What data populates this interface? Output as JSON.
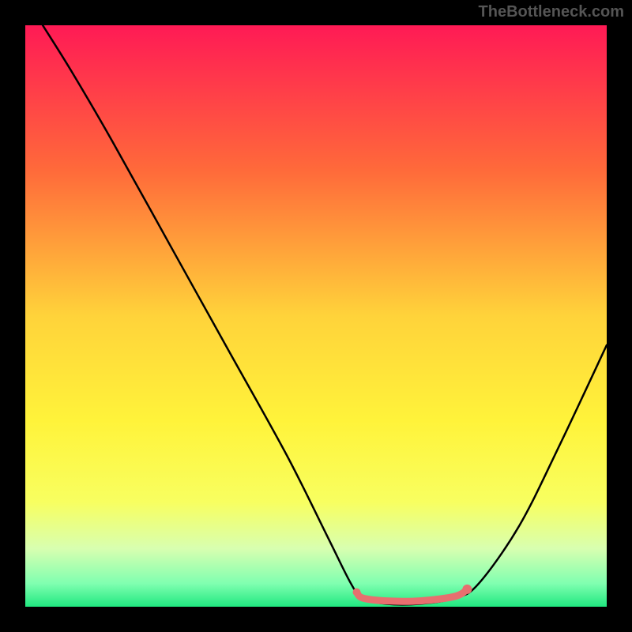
{
  "attribution": "TheBottleneck.com",
  "chart_data": {
    "type": "line",
    "title": "",
    "xlabel": "",
    "ylabel": "",
    "xlim": [
      0,
      100
    ],
    "ylim": [
      0,
      100
    ],
    "background_gradient": {
      "stops": [
        {
          "offset": 0,
          "color": "#ff1a55"
        },
        {
          "offset": 0.25,
          "color": "#ff6a3a"
        },
        {
          "offset": 0.5,
          "color": "#ffd33a"
        },
        {
          "offset": 0.68,
          "color": "#fff33a"
        },
        {
          "offset": 0.82,
          "color": "#f8ff60"
        },
        {
          "offset": 0.9,
          "color": "#d8ffb0"
        },
        {
          "offset": 0.96,
          "color": "#80ffb0"
        },
        {
          "offset": 1.0,
          "color": "#20e880"
        }
      ]
    },
    "series": [
      {
        "name": "bottleneck-curve",
        "color": "#000000",
        "points": [
          {
            "x": 3,
            "y": 100
          },
          {
            "x": 8,
            "y": 92
          },
          {
            "x": 15,
            "y": 80
          },
          {
            "x": 25,
            "y": 62
          },
          {
            "x": 35,
            "y": 44
          },
          {
            "x": 45,
            "y": 26
          },
          {
            "x": 52,
            "y": 12
          },
          {
            "x": 56,
            "y": 4
          },
          {
            "x": 58,
            "y": 1.5
          },
          {
            "x": 62,
            "y": 0.5
          },
          {
            "x": 68,
            "y": 0.5
          },
          {
            "x": 74,
            "y": 1.5
          },
          {
            "x": 78,
            "y": 4
          },
          {
            "x": 85,
            "y": 14
          },
          {
            "x": 92,
            "y": 28
          },
          {
            "x": 100,
            "y": 45
          }
        ]
      },
      {
        "name": "optimal-band",
        "color": "#e76f6f",
        "points": [
          {
            "x": 57,
            "y": 2.5
          },
          {
            "x": 58,
            "y": 1.5
          },
          {
            "x": 62,
            "y": 1
          },
          {
            "x": 68,
            "y": 1
          },
          {
            "x": 74,
            "y": 1.8
          },
          {
            "x": 76,
            "y": 3
          }
        ]
      }
    ],
    "markers": [
      {
        "name": "optimal-start-dot",
        "x": 57,
        "y": 2.5,
        "r": 5,
        "color": "#e76f6f"
      },
      {
        "name": "optimal-end-dot",
        "x": 76,
        "y": 3,
        "r": 6,
        "color": "#e76f6f"
      }
    ]
  }
}
